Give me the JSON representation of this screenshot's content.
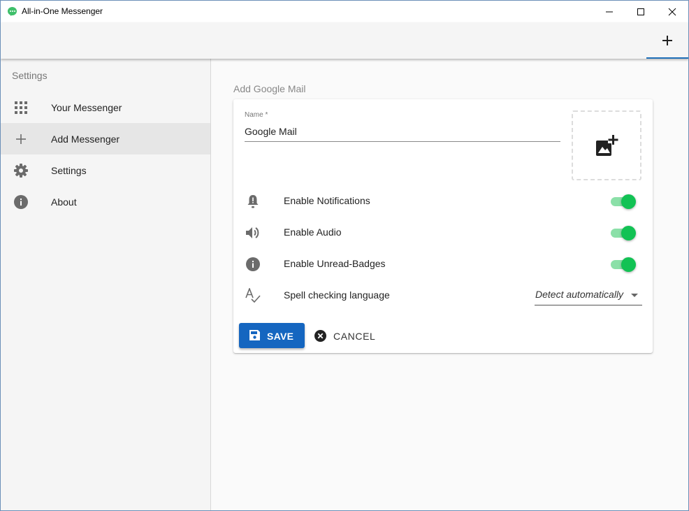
{
  "window": {
    "title": "All-in-One Messenger",
    "icons": {
      "app": "messenger-app-icon",
      "minimize": "minimize-icon",
      "maximize": "maximize-icon",
      "close": "close-icon"
    }
  },
  "toolbar": {
    "add_tab_icon": "plus-icon",
    "accent_color": "#1e6fb8"
  },
  "sidebar": {
    "title": "Settings",
    "items": [
      {
        "label": "Your Messenger",
        "icon": "grid-icon",
        "active": false
      },
      {
        "label": "Add Messenger",
        "icon": "plus-icon",
        "active": true
      },
      {
        "label": "Settings",
        "icon": "gear-icon",
        "active": false
      },
      {
        "label": "About",
        "icon": "info-icon",
        "active": false
      }
    ]
  },
  "form": {
    "section_title": "Add Google Mail",
    "name_label": "Name *",
    "name_value": "Google Mail",
    "image_picker_icon": "add-photo-icon",
    "options": [
      {
        "label": "Enable Notifications",
        "icon": "bell-alert-icon",
        "enabled": true
      },
      {
        "label": "Enable Audio",
        "icon": "volume-icon",
        "enabled": true
      },
      {
        "label": "Enable Unread-Badges",
        "icon": "info-icon",
        "enabled": true
      }
    ],
    "spellcheck": {
      "label": "Spell checking language",
      "icon": "spellcheck-icon",
      "selected": "Detect automatically"
    },
    "save_label": "SAVE",
    "cancel_label": "CANCEL",
    "colors": {
      "primary": "#1566c0",
      "switch_on": "#12c254"
    }
  }
}
